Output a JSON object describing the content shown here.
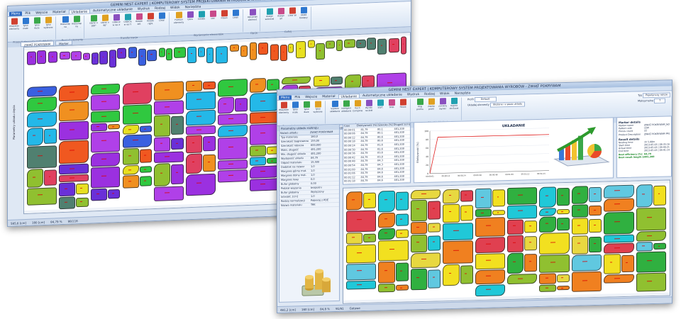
{
  "window1": {
    "title": "GEMINI NEST EXPERT | KOMPUTEROWY SYSTEM PROJEKTOWANIA WYROBÓW Z WYNIKIEM (OPT) ZESTAW_1.NES",
    "ribbon_tabs": [
      "Menu",
      "Plik",
      "Wejscie",
      "Materiał",
      "Układanie",
      "Automatyczne układanie",
      "Wydruk",
      "Rodzaj",
      "Widok",
      "Narzędzia"
    ],
    "groups": [
      {
        "label": "Przesuń elementy nad układem",
        "buttons": [
          "Wszystkie elementy",
          "Tylko małe",
          "Tylko duże",
          "Tylko wybrane"
        ]
      },
      {
        "label": "Rozsuń elementy",
        "buttons": [
          "Rozsunięcie na długość",
          "Rozsunięcie na szerokość"
        ]
      },
      {
        "label": "Transformacje",
        "buttons": [
          "Obróć o 180°",
          "Obróć o 90°",
          "Odbicie w osi X",
          "Odbicie w osi Y",
          "Rotate left",
          "Rotate right",
          "Clear"
        ]
      },
      {
        "label": "Wyrównanie elementów",
        "buttons": [
          "Przesuń elementy ułożone",
          "Góra",
          "Środek",
          "Dół",
          "Prawo",
          "Lewo"
        ]
      },
      {
        "label": "Opcje",
        "buttons": [
          "Opcjonalny element"
        ]
      },
      {
        "label": "Cofnij",
        "buttons": [
          "Assign selected",
          "Assign all",
          "Clear all",
          "Układ bieżący"
        ]
      }
    ],
    "doc_tabs": [
      "ZWIĄT POKRYWAM",
      "Marker"
    ],
    "side_label": "Parametry układu cięcia",
    "status": [
      "585,6 [cm]",
      "180 [cm]",
      "84,79 %",
      "98/118"
    ]
  },
  "window2": {
    "title": "GEMINI NEST EXPERT | KOMPUTEROWY SYSTEM PROJEKTOWANIA WYROBÓW - ZWIĄT POKRYWAM",
    "ribbon_tabs": [
      "Menu",
      "Plik",
      "Wejscie",
      "Materiał",
      "Układanie",
      "Automatyczne układanie",
      "Wydruk",
      "Rodzaj",
      "Widok",
      "Narzędzia"
    ],
    "groups": [
      {
        "label": "Przesuń elementy nad układem",
        "buttons": [
          "Wszystkie elementy",
          "Tylko małe",
          "Tylko duże",
          "Tylko wybrane"
        ]
      },
      {
        "label": "Automatyczne układanie",
        "buttons": [
          "Szybkie układanie",
          "Inteligentne układanie",
          "Ruch Component",
          "Wyniki na Arkł",
          "Start",
          "Stop",
          "Pauza"
        ]
      },
      {
        "label": "Wyniki układania",
        "buttons": [
          "Użyj profilu",
          "Zapisz profil",
          "Zamknij wyniki",
          "Rapott do Excel"
        ]
      }
    ],
    "profile": {
      "label": "Profil",
      "value": "Default"
    },
    "elements": {
      "label": "Układaj elementy",
      "value": "Ułożone i z poza układu"
    },
    "type": {
      "label": "Typ",
      "value": "Pojedynczy rolsze"
    },
    "width": {
      "label": "Maksymalna",
      "value": "7"
    },
    "doc_tabs": [
      "ZWIĄT POKRYWAM*",
      "ROZGŁOLA PRODUKCJI",
      "SPODNIE PROSTE"
    ],
    "params": {
      "title": "Parametry układu rozkroju",
      "header": [
        "Nazwa układu",
        "ZWIĄT POKRYWAM"
      ],
      "rows": [
        [
          "Typ materiału",
          "160,0"
        ],
        [
          "Szerokość bagnowana",
          "155,00"
        ],
        [
          "Szerokość robocza",
          "600,000"
        ],
        [
          "Maks. długość",
          "481,200"
        ],
        [
          "Min. długość układu",
          "481,200"
        ],
        [
          "Wydajność układu",
          "84,79"
        ],
        [
          "Odpad materiału",
          "15,500"
        ],
        [
          "Dodatek na rozwar",
          "1,0"
        ],
        [
          "Margines górny mat.",
          "1,0"
        ],
        [
          "Margines dolny mat.",
          "1,0"
        ],
        [
          "Margines lewy",
          "0,0"
        ],
        [
          "Bufor globalny",
          "0,00"
        ],
        [
          "Podział wiązania",
          "bezpośni"
        ],
        [
          "Bufor globalny",
          "Wyłączony"
        ],
        [
          "Interakt. [cm]",
          "1,0"
        ],
        [
          "Rodzaj normalizacji",
          "Pobieraj z PDE"
        ],
        [
          "Nazwa materiału",
          "TAK"
        ]
      ]
    },
    "results": {
      "header": [
        "Czas",
        "Efektywność [%]",
        "Szeroko [%]",
        "Długość [cm]"
      ],
      "rows": [
        [
          "00:00:01",
          "81,79",
          "80,1",
          "481,200"
        ],
        [
          "00:00:06",
          "84,79",
          "80,1",
          "481,200"
        ],
        [
          "00:00:12",
          "84,79",
          "80,6",
          "481,200"
        ],
        [
          "00:00:18",
          "84,79",
          "80,6",
          "481,200"
        ],
        [
          "00:00:24",
          "84,79",
          "81,6",
          "481,200"
        ],
        [
          "00:00:30",
          "84,79",
          "82,6",
          "481,200"
        ],
        [
          "00:00:36",
          "84,79",
          "83,6",
          "481,200"
        ],
        [
          "00:00:42",
          "84,79",
          "83,8",
          "481,200"
        ],
        [
          "00:00:48",
          "84,79",
          "84,3",
          "481,200"
        ],
        [
          "00:00:54",
          "84,79",
          "84,3",
          "481,200"
        ],
        [
          "00:01:00",
          "84,79",
          "84,6",
          "481,200"
        ],
        [
          "00:01:06",
          "84,79",
          "84,6",
          "481,200"
        ],
        [
          "00:01:12",
          "84,79",
          "84,6",
          "481,200"
        ],
        [
          "00:01:18",
          "84,79",
          "84,6",
          "481,200"
        ],
        [
          "00:01:24",
          "84,79",
          "84,6",
          "481,200"
        ],
        [
          "00:01:30",
          "84,79",
          "84,8",
          "481,200"
        ]
      ]
    },
    "chart_data": {
      "type": "line",
      "title": "UKŁADANIE",
      "ylabel": "Efektywność [%]",
      "x": [
        "00:00:01",
        "00:00:06",
        "00:00:12",
        "00:00:18",
        "00:00:24",
        "00:00:30",
        "00:00:36",
        "00:00:42",
        "00:00:48",
        "00:00:54",
        "00:01:00",
        "00:01:06",
        "00:01:12",
        "00:01:18",
        "00:01:24",
        "00:01:30"
      ],
      "series": [
        {
          "values": [
            0,
            84.79,
            84.79,
            84.79,
            84.79,
            84.79,
            84.79,
            84.79,
            84.79,
            84.79,
            84.79,
            84.79,
            84.79,
            84.79,
            84.79,
            84.79
          ],
          "color": "#e02020"
        }
      ],
      "ylim": [
        0,
        100
      ],
      "grid": true
    },
    "details": {
      "marker_title": "Marker details",
      "marker": [
        [
          "Marker name",
          "ZWIĄT POKRYWAM_NO"
        ],
        [
          "Pattern side",
          "LEW"
        ],
        [
          "Pieces count",
          "22"
        ],
        [
          "Product Description",
          "ZWIĄT POKRYWAM PRODUKCJI"
        ]
      ],
      "result_title": "Result details",
      "result": [
        [
          "Nesting time",
          "1h 5,08m"
        ],
        [
          "Start time",
          "2013-05-03 | 08:35:16"
        ],
        [
          "Actual time",
          "2013-05-03 | 09:40:21"
        ],
        [
          "End time",
          "2013-05-03 | 09:41:14"
        ],
        [
          "Best efficiency [%]",
          "84,79"
        ],
        [
          "Best result length [cm]",
          "481,200"
        ]
      ]
    },
    "status": [
      "481,2 [cm]",
      "160 [cm]",
      "84,8 %",
      "91/91",
      "Gotowe"
    ]
  },
  "colors": {
    "ribbon_blue": "#2e6bc3",
    "chart_line": "#e02020"
  }
}
